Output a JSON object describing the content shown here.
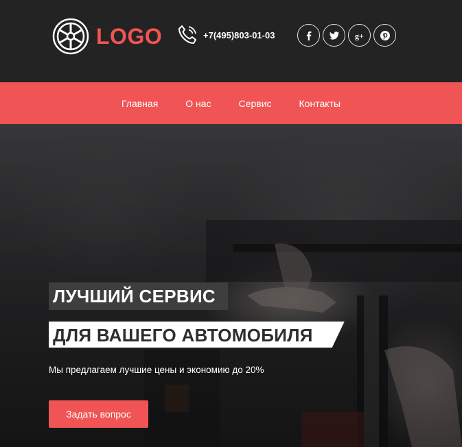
{
  "header": {
    "logo_text": "LOGO",
    "phone": "+7(495)803-01-03",
    "social": [
      {
        "name": "facebook-icon"
      },
      {
        "name": "twitter-icon"
      },
      {
        "name": "google-plus-icon",
        "label": "g+"
      },
      {
        "name": "pinterest-icon"
      }
    ]
  },
  "nav": {
    "items": [
      "Главная",
      "О нас",
      "Сервис",
      "Контакты"
    ]
  },
  "hero": {
    "title_line1": "ЛУЧШИЙ СЕРВИС",
    "title_line2": "ДЛЯ ВАШЕГО АВТОМОБИЛЯ",
    "subtitle": "Мы предлагаем лучшие цены и экономию до 20%",
    "cta_label": "Задать вопрос"
  },
  "colors": {
    "accent": "#f05454",
    "header_bg": "#232323"
  }
}
